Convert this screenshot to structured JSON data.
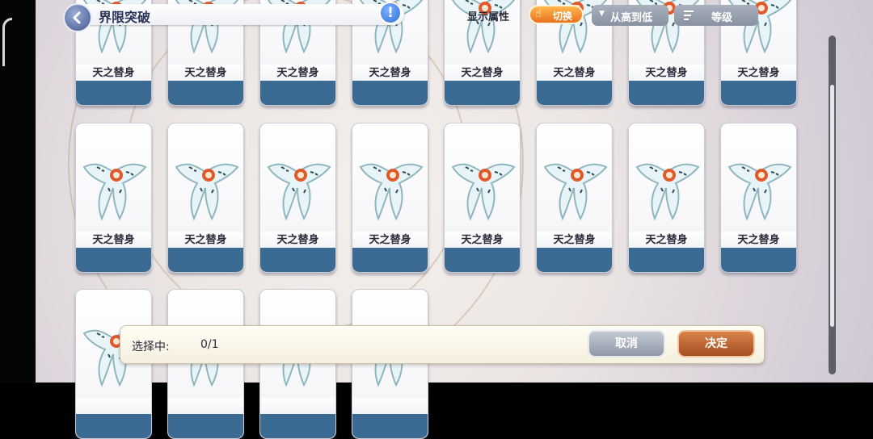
{
  "header": {
    "title": "界限突破",
    "info_label": "!",
    "attr_label": "显示属性",
    "switch_label": "切换",
    "sort_label": "从高到低",
    "level_label": "等级"
  },
  "cards": [
    {
      "name": "天之替身"
    },
    {
      "name": "天之替身"
    },
    {
      "name": "天之替身"
    },
    {
      "name": "天之替身"
    },
    {
      "name": "天之替身"
    },
    {
      "name": "天之替身"
    },
    {
      "name": "天之替身"
    },
    {
      "name": "天之替身"
    },
    {
      "name": "天之替身"
    },
    {
      "name": "天之替身"
    },
    {
      "name": "天之替身"
    },
    {
      "name": "天之替身"
    },
    {
      "name": "天之替身"
    },
    {
      "name": "天之替身"
    },
    {
      "name": "天之替身"
    },
    {
      "name": "天之替身"
    },
    {
      "name": ""
    },
    {
      "name": ""
    },
    {
      "name": ""
    },
    {
      "name": ""
    }
  ],
  "selection": {
    "label": "选择中:",
    "count": "0/1",
    "cancel_label": "取消",
    "confirm_label": "决定"
  },
  "colors": {
    "card_bottom": "#3b6a93",
    "switch_button": "#e8711e",
    "confirm_button": "#a54e22",
    "cancel_button": "#8f98a6"
  }
}
